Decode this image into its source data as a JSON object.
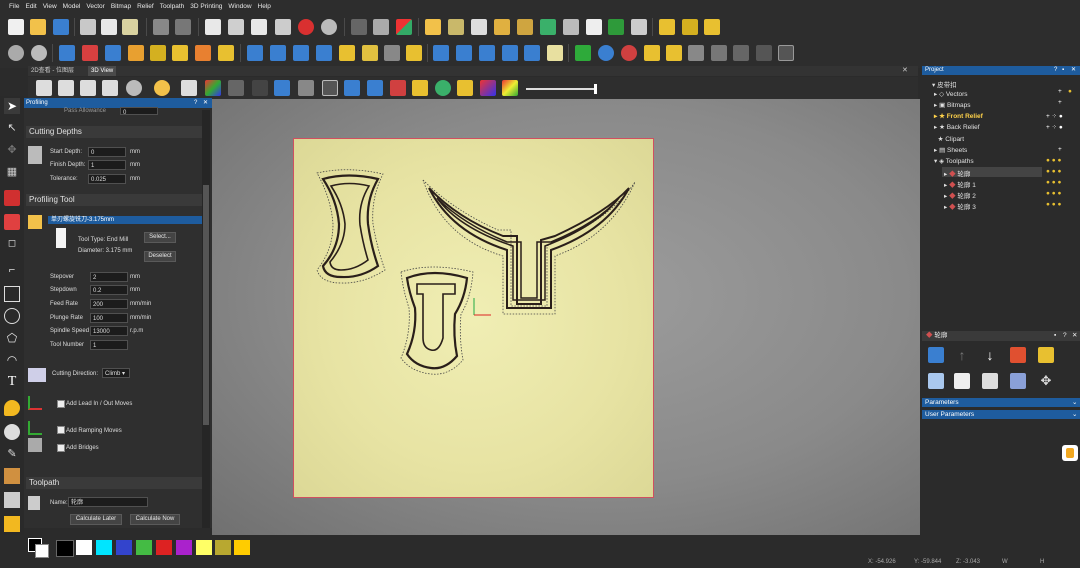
{
  "menu": [
    "File",
    "Edit",
    "View",
    "Model",
    "Vector",
    "Bitmap",
    "Relief",
    "Toolpath",
    "3D Printing",
    "Window",
    "Help"
  ],
  "view_tabs": [
    "2D查看 - 位图层",
    "3D View"
  ],
  "profiling": {
    "title": "Profiling",
    "truncated_row": "Pass Allowance",
    "truncated_value": "0",
    "cutting_depths": {
      "header": "Cutting Depths",
      "start_label": "Start Depth:",
      "start_value": "0",
      "start_unit": "mm",
      "finish_label": "Finish Depth:",
      "finish_value": "1",
      "finish_unit": "mm",
      "tol_label": "Tolerance:",
      "tol_value": "0.025",
      "tol_unit": "mm"
    },
    "tool": {
      "header": "Profiling Tool",
      "selected": "单刃螺旋铣刀-3.175mm",
      "type": "Tool Type: End Mill",
      "diameter": "Diameter:  3.175 mm",
      "select_label": "Select...",
      "deselect_label": "Deselect",
      "stepover_label": "Stepover",
      "stepover_value": "2",
      "stepover_unit": "mm",
      "stepdown_label": "Stepdown",
      "stepdown_value": "0.2",
      "stepdown_unit": "mm",
      "feed_label": "Feed Rate",
      "feed_value": "200",
      "feed_unit": "mm/min",
      "plunge_label": "Plunge Rate",
      "plunge_value": "100",
      "plunge_unit": "mm/min",
      "spindle_label": "Spindle Speed",
      "spindle_value": "13000",
      "spindle_unit": "r.p.m",
      "toolnum_label": "Tool Number",
      "toolnum_value": "1"
    },
    "direction_label": "Cutting Direction:",
    "direction_value": "Climb",
    "lead_label": "Add Lead In / Out Moves",
    "ramping_label": "Add Ramping Moves",
    "bridges_label": "Add Bridges",
    "toolpath": {
      "header": "Toolpath",
      "name_label": "Name:",
      "name_value": "轮廓",
      "calc_later": "Calculate Later",
      "calc_now": "Calculate Now"
    }
  },
  "project": {
    "title": "Project",
    "root": "皮带扣",
    "items": [
      {
        "label": "Vectors",
        "gold": false
      },
      {
        "label": "Bitmaps",
        "gold": false
      },
      {
        "label": "Front Relief",
        "gold": true
      },
      {
        "label": "Back Relief",
        "gold": false
      },
      {
        "label": "Clipart",
        "gold": false
      },
      {
        "label": "Sheets",
        "gold": false
      },
      {
        "label": "Toolpaths",
        "gold": false
      }
    ],
    "toolpaths": [
      "轮廓",
      "轮廓 1",
      "轮廓 2",
      "轮廓 3"
    ]
  },
  "contour_panel": {
    "title": "轮廓",
    "parameters": "Parameters",
    "user_parameters": "User Parameters"
  },
  "status": {
    "x": "X: -54.926",
    "y": "Y: -59.844",
    "z": "Z: -3.043",
    "w": "W",
    "h": "H"
  },
  "colors": {
    "accent": "#1e5c9e",
    "material": "#e7e3a3",
    "toolpath": "#2a1f1a",
    "palette": [
      "#000000",
      "#ffffff",
      "#00e5ff",
      "#3344cc",
      "#44bb44",
      "#dd2222",
      "#aa22cc",
      "#ffff66",
      "#b8a830",
      "#ffcc00"
    ]
  },
  "icons": [
    "select-icon",
    "edit-nodes-icon",
    "transform-icon",
    "pen-icon",
    "eraser-icon",
    "text-icon",
    "circle-icon",
    "rectangle-icon"
  ]
}
